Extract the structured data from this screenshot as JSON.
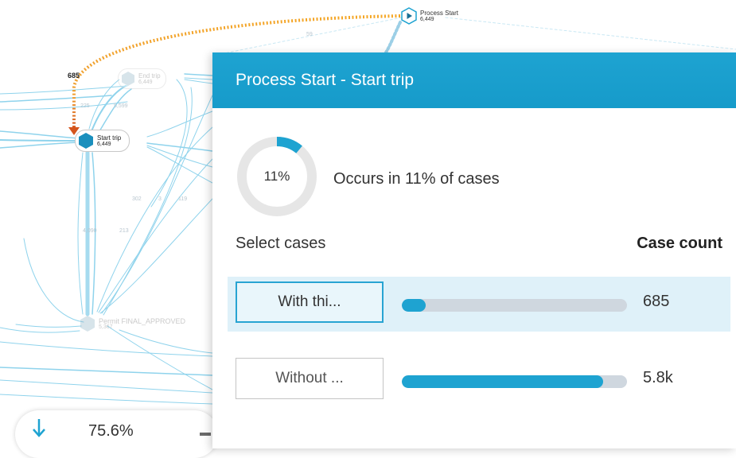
{
  "map": {
    "nodes": [
      {
        "id": "process-start",
        "name": "Process Start",
        "count": "6,449"
      },
      {
        "id": "end-trip",
        "name": "End trip",
        "count": "6,449"
      },
      {
        "id": "start-trip",
        "name": "Start trip",
        "count": "6,449"
      },
      {
        "id": "permit-final-approved",
        "name": "Permit FINAL_APPROVED",
        "count": "5,367"
      }
    ],
    "edge_labels": {
      "highlighted": "685",
      "ps_to_end": "59",
      "left_225": "225",
      "left_5599": "5,599",
      "mid_302": "302",
      "mid_3": "3",
      "mid_119": "119",
      "left_4090": "4,090",
      "left_213": "213"
    }
  },
  "panel": {
    "title": "Process Start - Start trip",
    "occurrence_percent": "11%",
    "occurrence_fraction": 0.11,
    "occurs_text": "Occurs in 11% of cases",
    "select_cases_label": "Select cases",
    "case_count_header": "Case count",
    "rows": [
      {
        "button_label": "With thi...",
        "count_label": "685",
        "count_value": 685,
        "fraction": 0.106
      },
      {
        "button_label": "Without ...",
        "count_label": "5.8k",
        "count_value": 5764,
        "fraction": 0.894
      }
    ]
  },
  "zoom": {
    "value": "75.6%"
  },
  "colors": {
    "accent": "#1ea3d1",
    "highlight_path_start": "#f5a623",
    "highlight_path_end": "#d4541c",
    "edge": "#8fd3ec",
    "donut_track": "#e6e6e6",
    "bar_track": "#cfd7df",
    "node_fill": "#1a8fbd"
  },
  "icons": {
    "play": "play-icon",
    "node": "hexagon-node-icon",
    "zoom": "arrow-down-icon"
  }
}
